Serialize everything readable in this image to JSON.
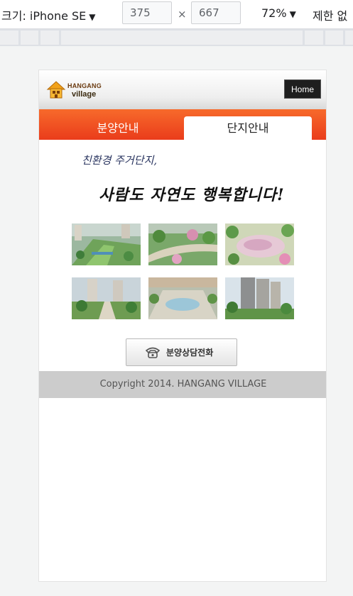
{
  "devtools": {
    "device_label": "크기: iPhone SE",
    "width_value": "375",
    "height_value": "667",
    "times_symbol": "×",
    "zoom_label": "72%",
    "throttle_label": "제한 없"
  },
  "site": {
    "logo": {
      "line1": "HANGANG",
      "line2": "village"
    },
    "home_button": "Home",
    "tabs": [
      {
        "label": "분양안내",
        "active": false
      },
      {
        "label": "단지안내",
        "active": true
      }
    ],
    "slogan_small": "친환경 주거단지,",
    "slogan_big": "사람도 자연도 행복합니다!",
    "gallery": [
      {
        "icon": "aerial-park-photo"
      },
      {
        "icon": "garden-path-photo"
      },
      {
        "icon": "playground-photo"
      },
      {
        "icon": "tower-walkway-photo"
      },
      {
        "icon": "plaza-fountain-photo"
      },
      {
        "icon": "apartment-tower-photo"
      }
    ],
    "call_button": "분양상담전화",
    "footer": "Copyright 2014. HANGANG VILLAGE"
  },
  "colors": {
    "tab_bar_top": "#f76a2b",
    "tab_bar_bottom": "#ea3c1b",
    "footer_bg": "#cccccc",
    "home_bg": "#1e1e1e"
  }
}
